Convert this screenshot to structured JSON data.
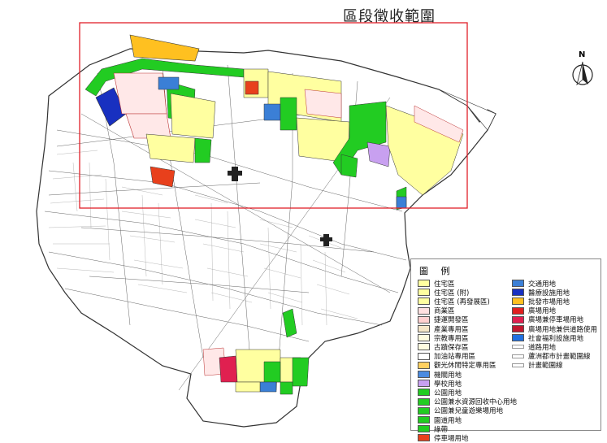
{
  "title": "區段徵收範圍",
  "north_label": "N",
  "legend": {
    "title": "圖 例",
    "left_column": [
      {
        "label": "住宅區",
        "color": "#ffffa0",
        "icon": "zone-swatch"
      },
      {
        "label": "住宅區 (附)",
        "color": "#ffffa0",
        "icon": "zone-swatch"
      },
      {
        "label": "住宅區 (再發展區)",
        "color": "#ffffa0",
        "icon": "zone-swatch"
      },
      {
        "label": "商業區",
        "color": "#ffe0e0",
        "icon": "zone-swatch"
      },
      {
        "label": "捷運開發區",
        "color": "#ffd0d0",
        "icon": "zone-swatch"
      },
      {
        "label": "產業專用區",
        "color": "#f5e6c8",
        "icon": "zone-swatch"
      },
      {
        "label": "宗教專用區",
        "color": "#fffbe0",
        "icon": "zone-swatch"
      },
      {
        "label": "古蹟保存區",
        "color": "#fffbe0",
        "icon": "zone-swatch"
      },
      {
        "label": "加油站專用區",
        "color": "#ffffff",
        "icon": "zone-swatch"
      },
      {
        "label": "觀光休閒特定專用區",
        "color": "#ffd060",
        "icon": "zone-swatch"
      },
      {
        "label": "機關用地",
        "color": "#4a8be0",
        "icon": "zone-swatch"
      },
      {
        "label": "學校用地",
        "color": "#c8a0f0",
        "icon": "zone-swatch"
      },
      {
        "label": "公園用地",
        "color": "#22cc22",
        "icon": "zone-swatch"
      },
      {
        "label": "公園兼水資源回收中心用地",
        "color": "#22cc22",
        "icon": "zone-swatch"
      },
      {
        "label": "公園兼兒童遊樂場用地",
        "color": "#22cc22",
        "icon": "zone-swatch"
      },
      {
        "label": "園道用地",
        "color": "#22cc22",
        "icon": "zone-swatch"
      },
      {
        "label": "綠帶",
        "color": "#22cc22",
        "icon": "zone-swatch"
      },
      {
        "label": "停車場用地",
        "color": "#e8401c",
        "icon": "zone-swatch"
      }
    ],
    "right_column": [
      {
        "label": "交通用地",
        "color": "#3b7fd6",
        "icon": "zone-swatch"
      },
      {
        "label": "醫療設施用地",
        "color": "#1830c0",
        "icon": "zone-swatch"
      },
      {
        "label": "批發市場用地",
        "color": "#ffc020",
        "icon": "zone-swatch"
      },
      {
        "label": "廣場用地",
        "color": "#e02020",
        "icon": "zone-swatch"
      },
      {
        "label": "廣場兼停車場用地",
        "color": "#e02050",
        "icon": "zone-swatch"
      },
      {
        "label": "廣場用地兼供道路使用",
        "color": "#c01830",
        "icon": "zone-swatch"
      },
      {
        "label": "社會福利設施用地",
        "color": "#2070e0",
        "icon": "zone-swatch"
      },
      {
        "label": "道路用地",
        "color": "#ffffff",
        "icon": "line-swatch"
      },
      {
        "label": "蘆洲都市計畫範圍線",
        "color": "#ffffff",
        "icon": "line-swatch"
      },
      {
        "label": "計畫範圍線",
        "color": "#ffffff",
        "icon": "line-swatch"
      }
    ]
  },
  "colors": {
    "boundary_red": "#e0202a",
    "road_line": "#555555",
    "residential": "#ffffa0",
    "park": "#22cc22",
    "commercial": "#ffe0e0"
  }
}
